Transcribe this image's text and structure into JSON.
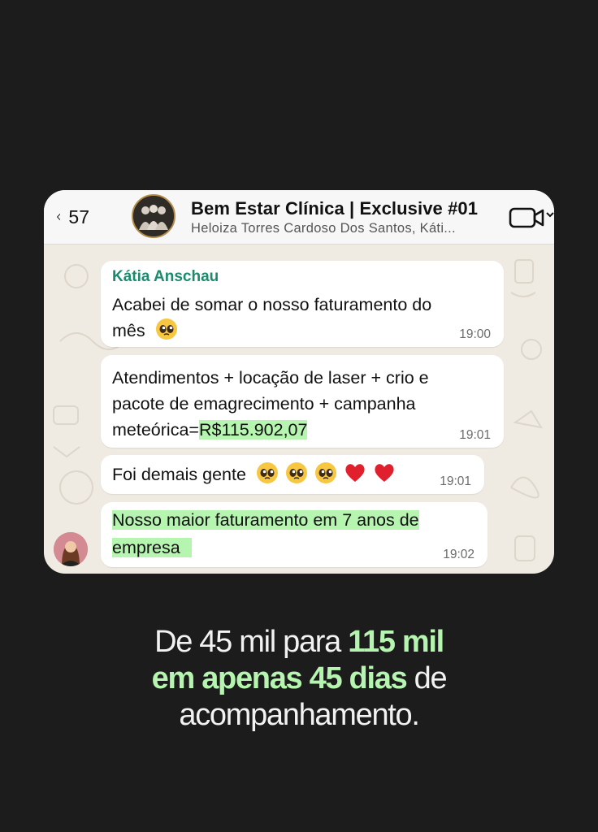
{
  "header": {
    "back_count": "57",
    "title": "Bem Estar Clínica | Exclusive #01",
    "subtitle": "Heloiza Torres Cardoso Dos Santos, Káti..."
  },
  "messages": {
    "m1": {
      "sender": "Kátia Anschau",
      "line1": "Acabei de somar o nosso faturamento do",
      "line2": "mês",
      "time": "19:00"
    },
    "m2": {
      "line1": "Atendimentos + locação de laser + crio e",
      "line2": "pacote de emagrecimento + campanha",
      "line3_prefix": "meteórica=",
      "amount": "R$115.902,07",
      "time": "19:01"
    },
    "m3": {
      "text": "Foi demais gente",
      "time": "19:01"
    },
    "m4": {
      "line1": "Nosso maior faturamento em 7 anos de",
      "line2": "empresa",
      "time": "19:02"
    }
  },
  "caption": {
    "l1_a": "De 45 mil para ",
    "l1_b": "115 mil",
    "l2_a": "em apenas 45 dias",
    "l2_b": " de",
    "l3": "acompanhamento."
  },
  "colors": {
    "highlight": "#b6f5b0",
    "sender": "#1d8a6e",
    "background": "#1c1c1c"
  }
}
